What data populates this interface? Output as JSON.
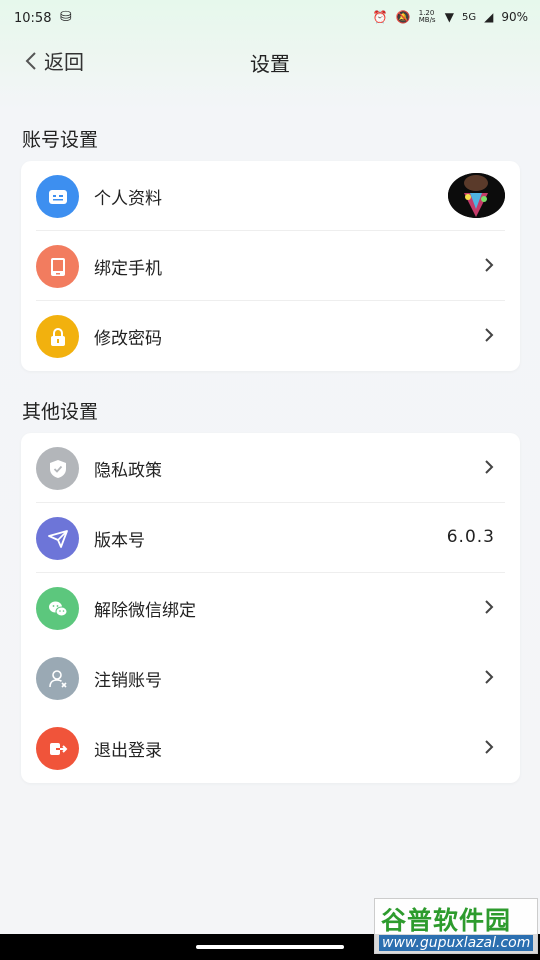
{
  "status_bar": {
    "time": "10:58",
    "net_speed": "1.20 MB/s",
    "network": "5G",
    "battery": "90%"
  },
  "nav": {
    "back_label": "返回",
    "title": "设置"
  },
  "account_section": {
    "title": "账号设置",
    "items": [
      {
        "label": "个人资料",
        "icon": "profile-card-icon",
        "color": "#3d8ff0"
      },
      {
        "label": "绑定手机",
        "icon": "phone-icon",
        "color": "#f27c5f"
      },
      {
        "label": "修改密码",
        "icon": "lock-icon",
        "color": "#f2b10e"
      }
    ]
  },
  "other_section": {
    "title": "其他设置",
    "items": [
      {
        "label": "隐私政策",
        "icon": "shield-icon",
        "color": "#b3b6ba"
      },
      {
        "label": "版本号",
        "icon": "plane-icon",
        "color": "#6d75d8",
        "value": "6.0.3"
      },
      {
        "label": "解除微信绑定",
        "icon": "wechat-icon",
        "color": "#5cc77d"
      },
      {
        "label": "注销账号",
        "icon": "user-remove-icon",
        "color": "#9aa9b4"
      },
      {
        "label": "退出登录",
        "icon": "logout-icon",
        "color": "#f0543a"
      }
    ]
  },
  "watermark": {
    "title": "谷普软件园",
    "url": "www.gupuxlazal.com"
  }
}
